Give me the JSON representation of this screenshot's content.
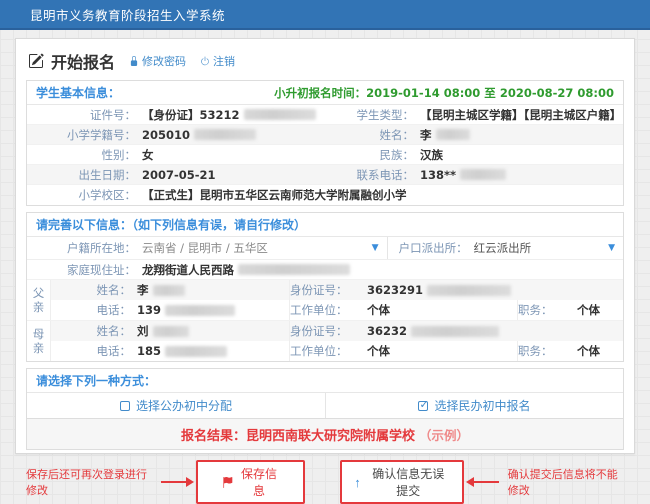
{
  "topbar": {
    "title": "昆明市义务教育阶段招生入学系统"
  },
  "toolbar": {
    "page_title": "开始报名",
    "change_password": "修改密码",
    "logout": "注销"
  },
  "student": {
    "section_title": "学生基本信息：",
    "deadline": "小升初报名时间：2019-01-14 08:00 至 2020-08-27 08:00",
    "rows": [
      {
        "l_label": "证件号：",
        "l_value": "【身份证】53212",
        "r_label": "学生类型：",
        "r_value": "【昆明主城区学籍】【昆明主城区户籍】"
      },
      {
        "l_label": "小学学籍号：",
        "l_value": "205010",
        "r_label": "姓名：",
        "r_value": "李"
      },
      {
        "l_label": "性别：",
        "l_value": "女",
        "r_label": "民族：",
        "r_value": "汉族"
      },
      {
        "l_label": "出生日期：",
        "l_value": "2007-05-21",
        "r_label": "联系电话：",
        "r_value": "138**"
      },
      {
        "l_label": "小学校区：",
        "l_value": "【正式生】昆明市五华区云南师范大学附属融创小学"
      }
    ]
  },
  "complete": {
    "section_title": "请完善以下信息：（如下列信息有误，请自行修改）",
    "hukou_label": "户籍所在地：",
    "hukou_value": "云南省 / 昆明市 / 五华区",
    "police_label": "户口派出所：",
    "police_value": "红云派出所",
    "address_label": "家庭现住址：",
    "address_value": "龙翔街道人民西路",
    "father": {
      "group": "父亲",
      "name_label": "姓名：",
      "name": "李",
      "id_label": "身份证号：",
      "id_value": "3623291",
      "phone_label": "电话：",
      "phone": "139",
      "work_label": "工作单位：",
      "work": "个体",
      "duty_label": "职务：",
      "duty": "个体"
    },
    "mother": {
      "group": "母亲",
      "name_label": "姓名：",
      "name": "刘",
      "id_label": "身份证号：",
      "id_value": "36232",
      "phone_label": "电话：",
      "phone": "185",
      "work_label": "工作单位：",
      "work": "个体",
      "duty_label": "职务：",
      "duty": "个体"
    }
  },
  "choice": {
    "section_title": "请选择下列一种方式：",
    "public_option": "选择公办初中分配",
    "private_option": "选择民办初中报名",
    "result_text": "报名结果：昆明西南联大研究院附属学校",
    "result_note": "（示例）"
  },
  "actions": {
    "save_hint": "保存后还可再次登录进行修改",
    "save_button": "保存信息",
    "submit_button": "确认信息无误提交",
    "submit_hint": "确认提交后信息将不能修改"
  },
  "colors": {
    "topbar_blue": "#3274b5",
    "link_blue": "#428bca",
    "section_blue": "#3b8edb",
    "label_blue_gray": "#7d96b5",
    "deadline_green": "#2f9b2f",
    "alert_red": "#e4393c",
    "stripe_gray": "#f5f5f5"
  }
}
